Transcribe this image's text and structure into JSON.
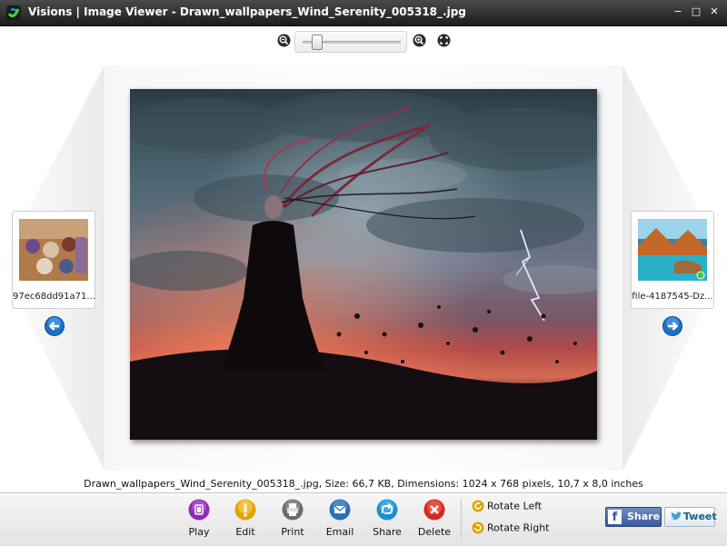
{
  "window": {
    "title": "Visions | Image Viewer - Drawn_wallpapers_Wind_Serenity_005318_.jpg",
    "minimize_label": "−",
    "maximize_label": "□",
    "close_label": "✕"
  },
  "zoom": {
    "level": 0.1,
    "icons": [
      "zoom-out-icon",
      "zoom-in-icon",
      "fit-to-window-icon"
    ]
  },
  "navigation": {
    "previous": {
      "caption": "97ec68dd91a71..."
    },
    "next": {
      "caption": "file-4187545-Dz..."
    }
  },
  "image_info": "Drawn_wallpapers_Wind_Serenity_005318_.jpg, Size: 66,7 KB, Dimensions: 1024 x 768 pixels, 10,7 x 8,0 inches",
  "toolbar": {
    "play": "Play",
    "edit": "Edit",
    "print": "Print",
    "email": "Email",
    "share": "Share",
    "delete": "Delete",
    "rotate_left": "Rotate Left",
    "rotate_right": "Rotate Right"
  },
  "social": {
    "facebook": "Share",
    "twitter": "Tweet"
  },
  "colors": {
    "titlebar": "#2b2b2b",
    "play": "#8e2bb5",
    "edit": "#e0a400",
    "print": "#6b6b6b",
    "email": "#2a6fb8",
    "share": "#1e8ed6",
    "delete": "#d62a1f",
    "facebook": "#3b5998",
    "twitter": "#1d5d85"
  }
}
